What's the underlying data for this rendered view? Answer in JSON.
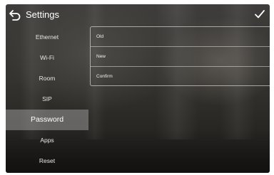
{
  "header": {
    "title": "Settings",
    "back_icon": "back-arrow-icon",
    "confirm_icon": "checkmark-icon"
  },
  "sidebar": {
    "items": [
      {
        "label": "Ethernet",
        "active": false
      },
      {
        "label": "Wi-Fi",
        "active": false
      },
      {
        "label": "Room",
        "active": false
      },
      {
        "label": "SIP",
        "active": false
      },
      {
        "label": "Password",
        "active": true
      },
      {
        "label": "Apps",
        "active": false
      },
      {
        "label": "Reset",
        "active": false
      }
    ]
  },
  "password_form": {
    "old_label": "Old",
    "old_value": "",
    "new_label": "New",
    "new_value": "",
    "confirm_label": "Confirm",
    "confirm_value": ""
  },
  "colors": {
    "text": "#ffffff",
    "active_highlight": "#9a9896",
    "border": "#d0d0d0"
  }
}
